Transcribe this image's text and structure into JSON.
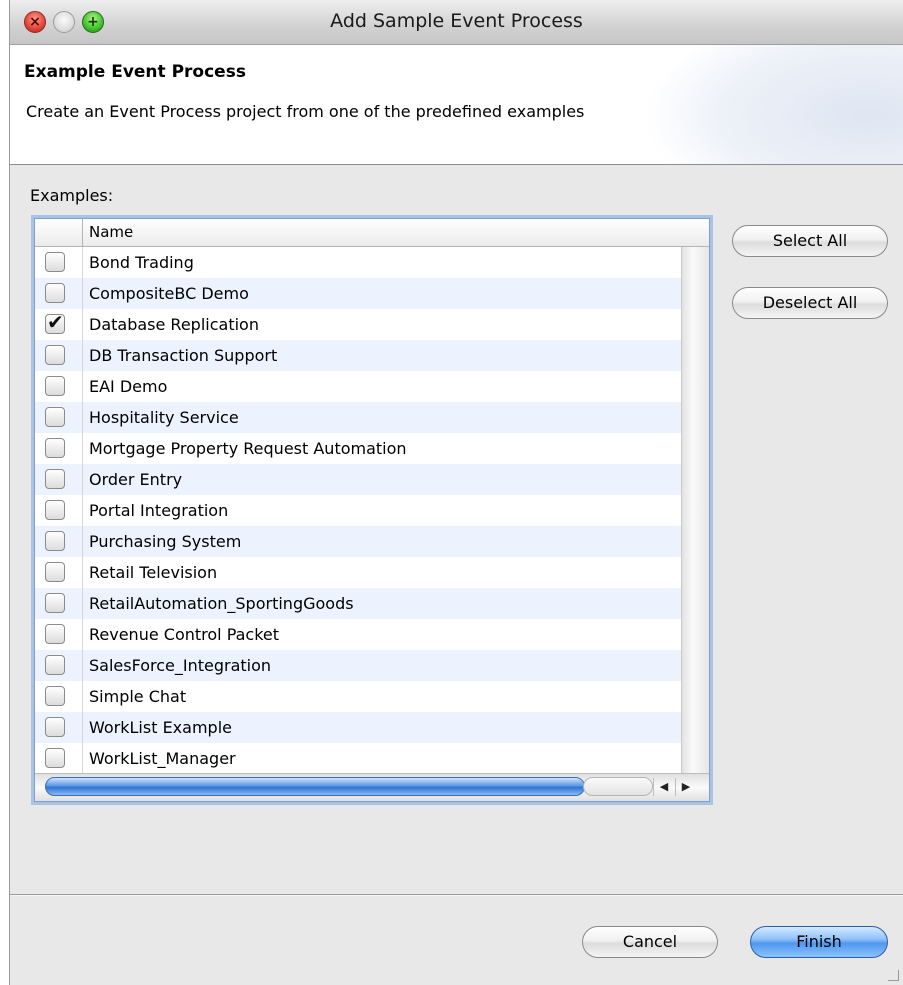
{
  "window": {
    "title": "Add Sample Event Process"
  },
  "banner": {
    "title": "Example Event Process",
    "description": "Create an Event Process project from one of the predefined examples"
  },
  "examples": {
    "label": "Examples:",
    "column_header": "Name",
    "items": [
      {
        "label": "Bond Trading",
        "checked": false
      },
      {
        "label": "CompositeBC Demo",
        "checked": false
      },
      {
        "label": "Database Replication",
        "checked": true
      },
      {
        "label": "DB Transaction Support",
        "checked": false
      },
      {
        "label": "EAI Demo",
        "checked": false
      },
      {
        "label": "Hospitality Service",
        "checked": false
      },
      {
        "label": "Mortgage Property Request Automation",
        "checked": false
      },
      {
        "label": "Order Entry",
        "checked": false
      },
      {
        "label": "Portal Integration",
        "checked": false
      },
      {
        "label": "Purchasing System",
        "checked": false
      },
      {
        "label": "Retail Television",
        "checked": false
      },
      {
        "label": "RetailAutomation_SportingGoods",
        "checked": false
      },
      {
        "label": "Revenue Control Packet",
        "checked": false
      },
      {
        "label": "SalesForce_Integration",
        "checked": false
      },
      {
        "label": "Simple Chat",
        "checked": false
      },
      {
        "label": "WorkList Example",
        "checked": false
      },
      {
        "label": "WorkList_Manager",
        "checked": false
      }
    ]
  },
  "buttons": {
    "select_all": "Select All",
    "deselect_all": "Deselect All",
    "cancel": "Cancel",
    "finish": "Finish"
  },
  "colors": {
    "selection_focus": "#a9c3e6",
    "row_alternate": "#edf3fe",
    "default_button": "#4f97ef"
  }
}
